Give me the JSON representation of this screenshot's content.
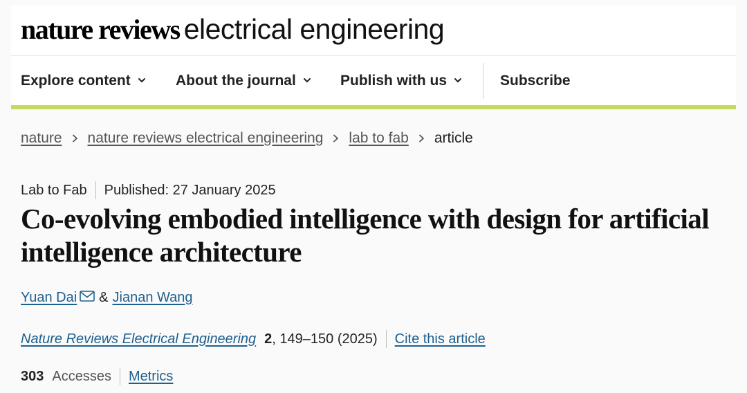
{
  "masthead": {
    "brand": "nature reviews",
    "subtitle": "electrical engineering"
  },
  "nav": {
    "items": [
      {
        "label": "Explore content",
        "has_dropdown": true
      },
      {
        "label": "About the journal",
        "has_dropdown": true
      },
      {
        "label": "Publish with us",
        "has_dropdown": true
      },
      {
        "label": "Subscribe",
        "has_dropdown": false
      }
    ],
    "accent_color": "#c9d95f"
  },
  "breadcrumb": {
    "items": [
      "nature",
      "nature reviews electrical engineering",
      "lab to fab"
    ],
    "current": "article"
  },
  "article": {
    "type": "Lab to Fab",
    "published": "Published: 27 January 2025",
    "title": "Co-evolving embodied intelligence with design for artificial intelligence architecture",
    "authors": [
      "Yuan Dai",
      "Jianan Wang"
    ],
    "author_separator": "&",
    "corresponding_icon": "mail-icon",
    "journal": "Nature Reviews Electrical Engineering",
    "volume": "2",
    "pages": ", 149–150 (2025)",
    "cite_label": "Cite this article",
    "accesses_count": "303",
    "accesses_label": "Accesses",
    "metrics_label": "Metrics",
    "link_color": "#1d5f8f"
  }
}
